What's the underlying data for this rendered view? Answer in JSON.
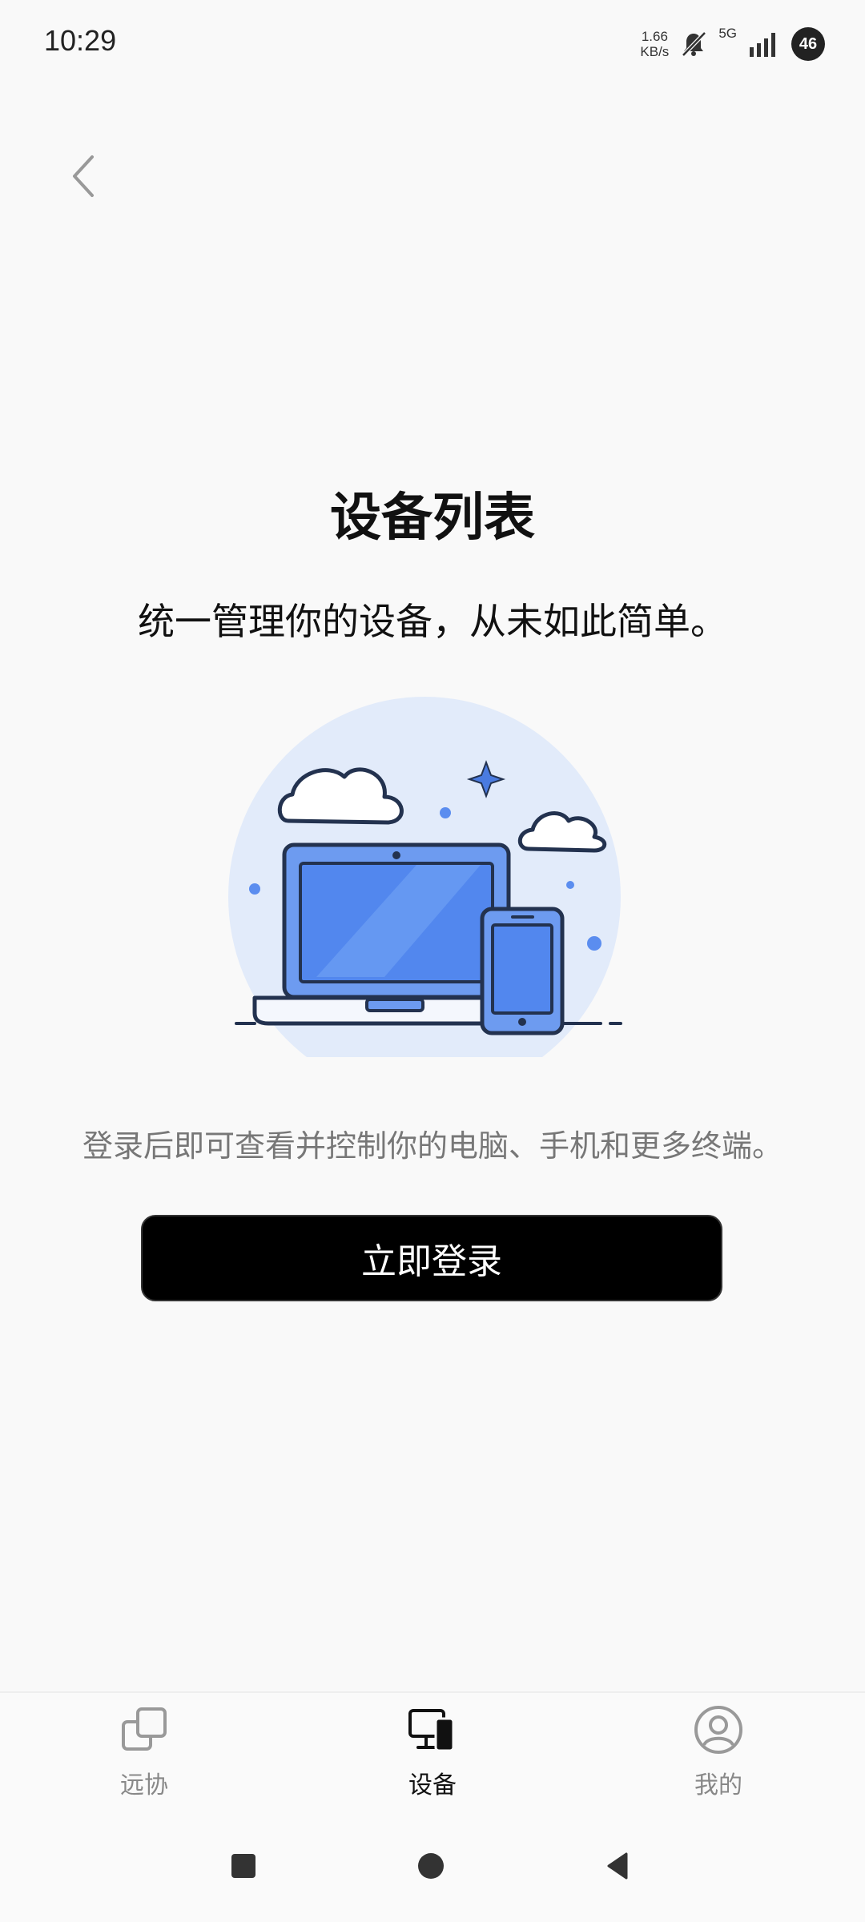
{
  "status_bar": {
    "time": "10:29",
    "net_speed_value": "1.66",
    "net_speed_unit": "KB/s",
    "network_type": "5G",
    "battery": "46",
    "icons": [
      "mute-bell-icon",
      "signal-icon"
    ]
  },
  "header": {
    "back_icon": "chevron-left-icon"
  },
  "main": {
    "title": "设备列表",
    "subtitle": "统一管理你的设备，从未如此简单。",
    "hint": "登录后即可查看并控制你的电脑、手机和更多终端。",
    "login_button": "立即登录"
  },
  "tab_bar": {
    "items": [
      {
        "label": "远协",
        "icon": "remote-assist-icon",
        "active": false
      },
      {
        "label": "设备",
        "icon": "devices-icon",
        "active": true
      },
      {
        "label": "我的",
        "icon": "profile-icon",
        "active": false
      }
    ]
  },
  "colors": {
    "accent": "#000000",
    "illustration_blue": "#5b8def",
    "muted_text": "#777777"
  }
}
